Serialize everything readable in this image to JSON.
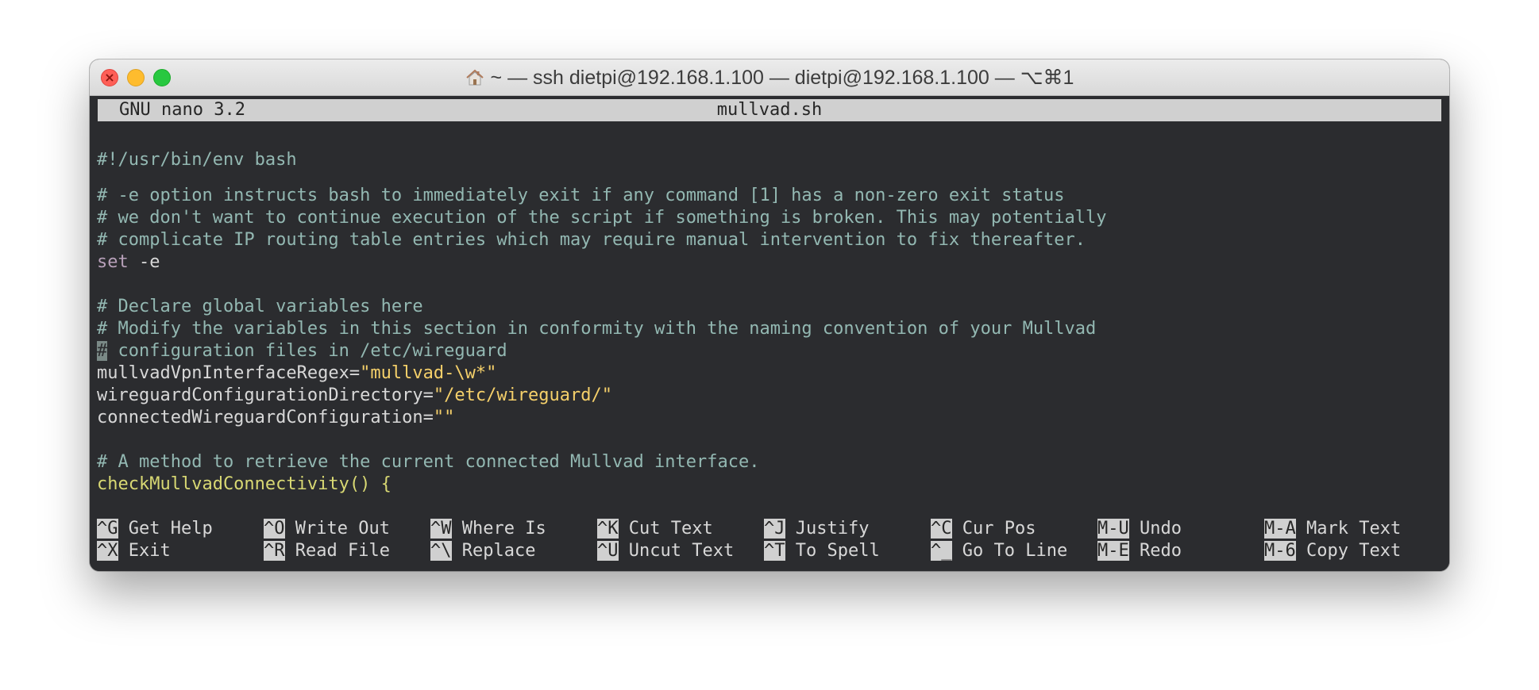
{
  "window": {
    "title": "~ — ssh dietpi@192.168.1.100 — dietpi@192.168.1.100 — ⌥⌘1",
    "title_icon": "home-icon",
    "colors": {
      "close": "#fe5f57",
      "minimize": "#febc2e",
      "maximize": "#28c840",
      "terminal_bg": "#2b2c2f"
    }
  },
  "nano": {
    "version": "GNU nano 3.2",
    "filename": "mullvad.sh"
  },
  "code": {
    "line1": "#!/usr/bin/env bash",
    "line3": "# -e option instructs bash to immediately exit if any command [1] has a non-zero exit status",
    "line4": "# we don't want to continue execution of the script if something is broken. This may potentially",
    "line5": "# complicate IP routing table entries which may require manual intervention to fix thereafter.",
    "line6_kw": "set",
    "line6_arg": " -e",
    "line8": "# Declare global variables here",
    "line9": "# Modify the variables in this section in conformity with the naming convention of your Mullvad",
    "line10_cursor": "#",
    "line10_rest": " configuration files in /etc/wireguard",
    "line11_name": "mullvadVpnInterfaceRegex=",
    "line11_value": "\"mullvad-\\w*\"",
    "line12_name": "wireguardConfigurationDirectory=",
    "line12_value": "\"/etc/wireguard/\"",
    "line13_name": "connectedWireguardConfiguration=",
    "line13_value": "\"\"",
    "line15": "# A method to retrieve the current connected Mullvad interface.",
    "line16": "checkMullvadConnectivity() {"
  },
  "shortcuts": {
    "row1": [
      {
        "key": "^G",
        "label": " Get Help"
      },
      {
        "key": "^O",
        "label": " Write Out"
      },
      {
        "key": "^W",
        "label": " Where Is"
      },
      {
        "key": "^K",
        "label": " Cut Text"
      },
      {
        "key": "^J",
        "label": " Justify"
      },
      {
        "key": "^C",
        "label": " Cur Pos"
      },
      {
        "key": "M-U",
        "label": " Undo"
      },
      {
        "key": "M-A",
        "label": " Mark Text"
      }
    ],
    "row2": [
      {
        "key": "^X",
        "label": " Exit"
      },
      {
        "key": "^R",
        "label": " Read File"
      },
      {
        "key": "^\\",
        "label": " Replace"
      },
      {
        "key": "^U",
        "label": " Uncut Text"
      },
      {
        "key": "^T",
        "label": " To Spell"
      },
      {
        "key": "^_",
        "label": " Go To Line"
      },
      {
        "key": "M-E",
        "label": " Redo"
      },
      {
        "key": "M-6",
        "label": " Copy Text"
      }
    ]
  }
}
